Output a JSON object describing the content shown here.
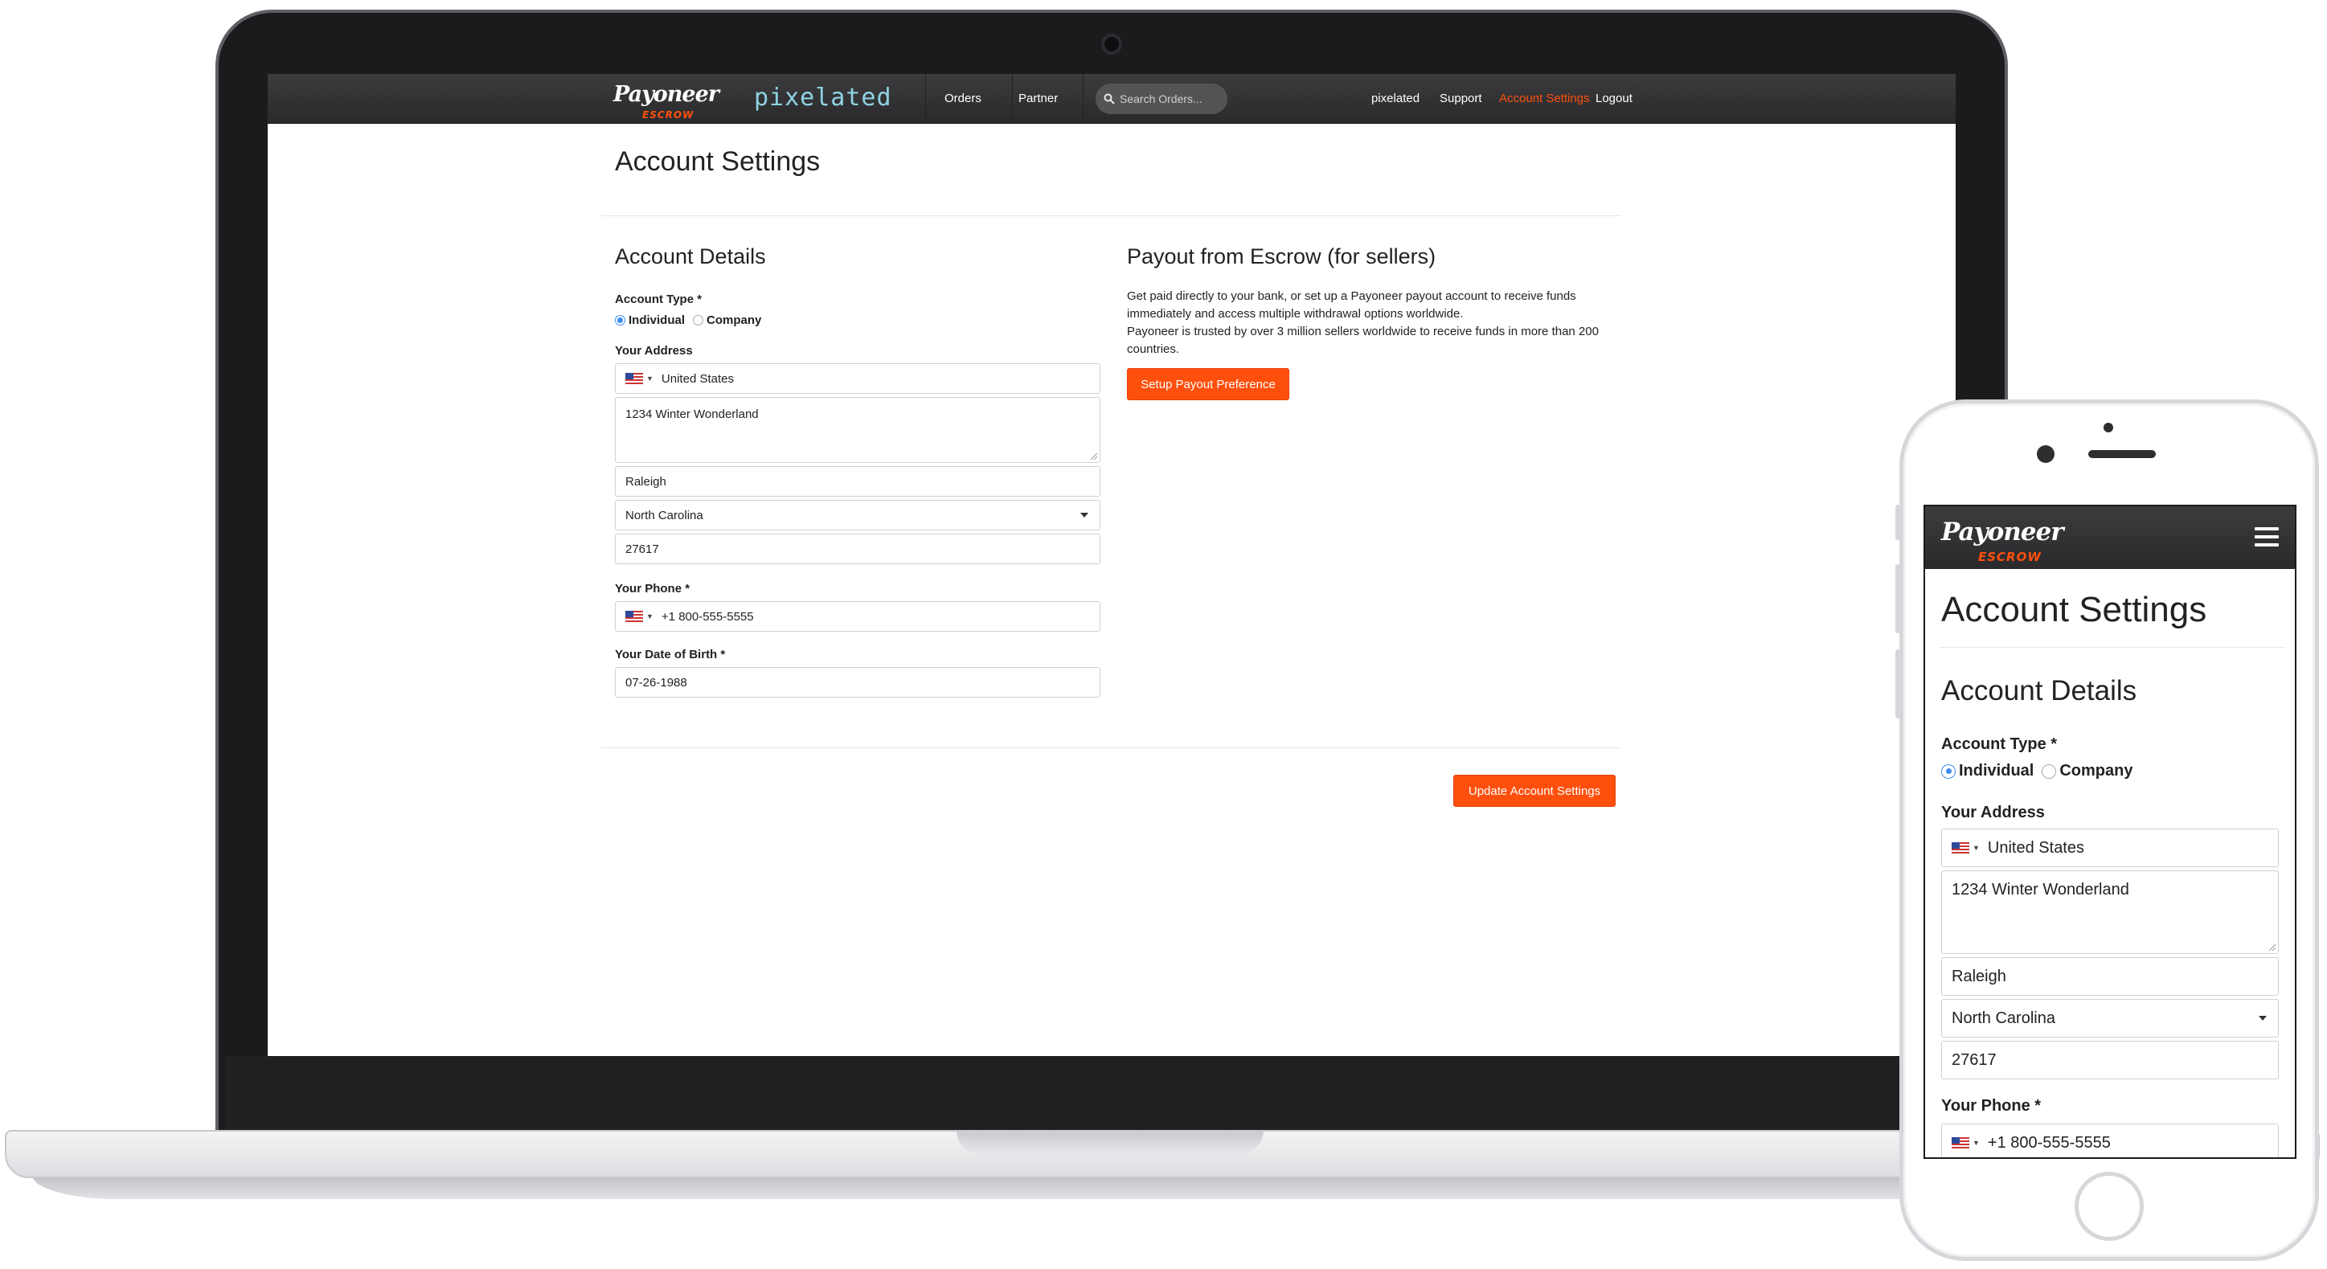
{
  "nav": {
    "logo_word": "Payoneer",
    "logo_sub": "ESCROW",
    "brand": "pixelated",
    "links": [
      "Orders",
      "Partner"
    ],
    "search_placeholder": "Search Orders...",
    "right_links": [
      "pixelated",
      "Support",
      "Account Settings",
      "Logout"
    ],
    "active_link": "Account Settings"
  },
  "page": {
    "title": "Account Settings",
    "account_details": {
      "heading": "Account Details",
      "account_type_label": "Account Type *",
      "account_type_options": [
        "Individual",
        "Company"
      ],
      "account_type_selected": "Individual",
      "address_label": "Your Address",
      "country": "United States",
      "street": "1234 Winter Wonderland",
      "city": "Raleigh",
      "state": "North Carolina",
      "zip": "27617",
      "phone_label": "Your Phone *",
      "phone": "+1 800-555-5555",
      "dob_label": "Your Date of Birth *",
      "dob": "07-26-1988"
    },
    "payout": {
      "heading": "Payout from Escrow (for sellers)",
      "para1": "Get paid directly to your bank, or set up a Payoneer payout account to receive funds immediately and access multiple withdrawal options worldwide.",
      "para2": "Payoneer is trusted by over 3 million sellers worldwide to receive funds in more than 200 countries.",
      "button": "Setup Payout Preference"
    },
    "update_button": "Update Account Settings"
  },
  "colors": {
    "accent": "#ff4f0d",
    "nav_bg": "#2f2f31",
    "brand_teal": "#8fd3e2",
    "radio_blue": "#3d8ef0"
  },
  "icons": [
    "search-icon",
    "us-flag-icon",
    "caret-down-icon",
    "hamburger-menu-icon"
  ]
}
